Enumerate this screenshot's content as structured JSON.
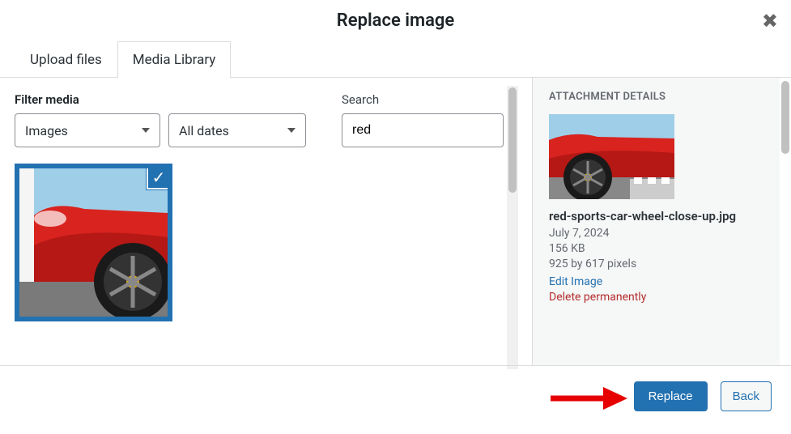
{
  "modal": {
    "title": "Replace image"
  },
  "tabs": {
    "upload": "Upload files",
    "library": "Media Library"
  },
  "filters": {
    "label": "Filter media",
    "type_value": "Images",
    "date_value": "All dates"
  },
  "search": {
    "label": "Search",
    "value": "red"
  },
  "details": {
    "heading": "ATTACHMENT DETAILS",
    "filename": "red-sports-car-wheel-close-up.jpg",
    "date": "July 7, 2024",
    "size": "156 KB",
    "dimensions": "925 by 617 pixels",
    "edit_link": "Edit Image",
    "delete_link": "Delete permanently"
  },
  "footer": {
    "replace": "Replace",
    "back": "Back"
  },
  "colors": {
    "primary": "#2271b1",
    "danger": "#b32d2e"
  }
}
